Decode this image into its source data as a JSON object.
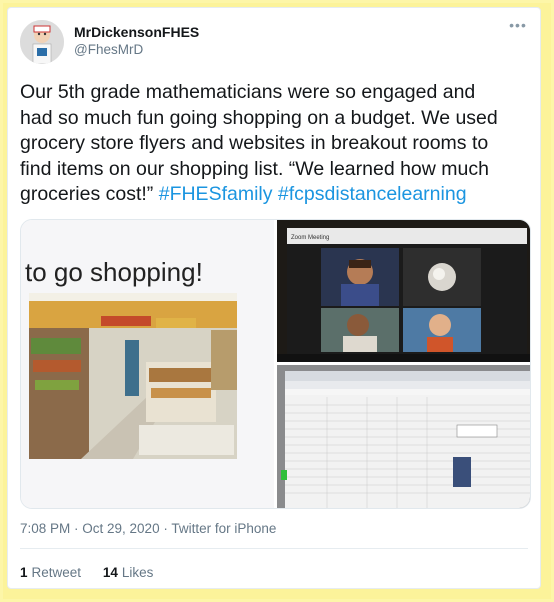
{
  "tweet": {
    "display_name": "MrDickensonFHES",
    "handle": "@FhesMrD",
    "more_icon": "ellipsis-icon",
    "text_plain": "Our 5th grade mathematicians were so engaged and had so much fun going shopping on a budget. We used grocery store flyers and websites in breakout rooms to find items on our shopping list. “We learned how much groceries cost!” ",
    "hashtags": [
      "#FHESfamily",
      "#fcpsdistancelearning"
    ],
    "timestamp": "7:08 PM · Oct 29, 2020 · Twitter for iPhone",
    "retweets_count": "1",
    "retweets_label": "Retweet",
    "likes_count": "14",
    "likes_label": "Likes"
  },
  "media": {
    "slide_caption": "to go shopping!",
    "zoom_title": "Zoom Meeting",
    "colors": {
      "hashtag": "#1b95e0",
      "card_border": "#fcf39a"
    }
  }
}
